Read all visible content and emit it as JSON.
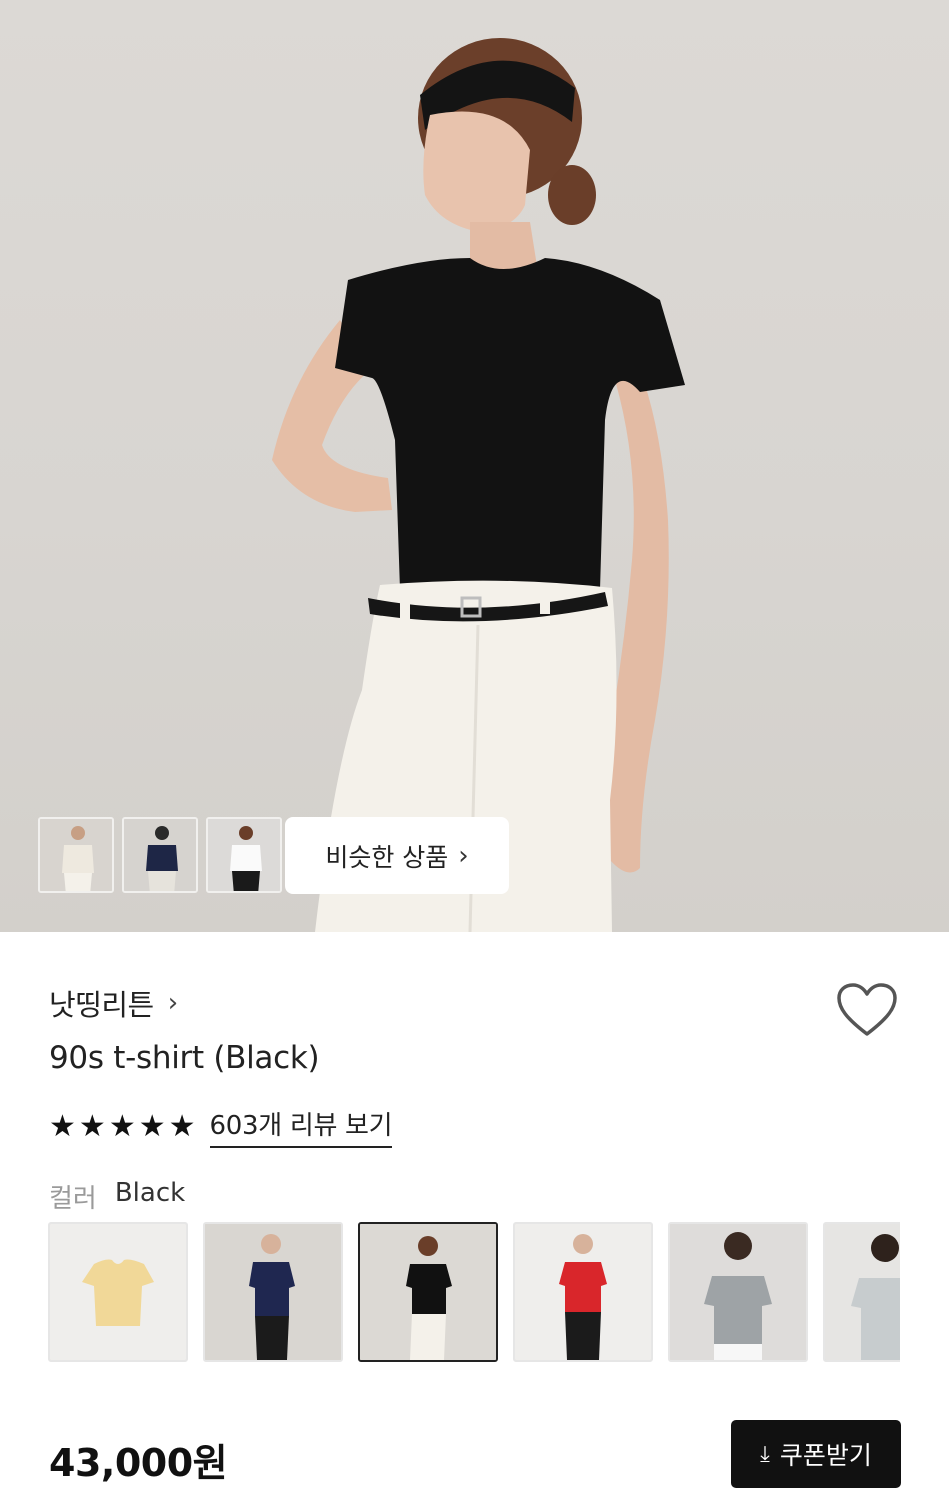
{
  "gallery": {
    "similar_label": "비슷한 상품",
    "thumbnails": [
      "thumb-ivory",
      "thumb-navy",
      "thumb-white"
    ]
  },
  "product": {
    "brand": "낫띵리튼",
    "title": "90s t-shirt (Black)",
    "rating_stars": 5,
    "review_link": "603개 리뷰 보기",
    "color_label": "컬러",
    "color_value": "Black",
    "price": "43,000원"
  },
  "swatches": [
    {
      "name": "yellow",
      "shirt": "#f1d898",
      "active": false
    },
    {
      "name": "navy",
      "shirt": "#1f2750",
      "active": false
    },
    {
      "name": "black",
      "shirt": "#111111",
      "active": true
    },
    {
      "name": "red",
      "shirt": "#d9262b",
      "active": false
    },
    {
      "name": "grey",
      "shirt": "#9ea3a6",
      "active": false
    },
    {
      "name": "light-grey",
      "shirt": "#c7ccce",
      "active": false
    }
  ],
  "actions": {
    "coupon_label": "쿠폰받기"
  },
  "icons": {
    "heart": "heart-outline-icon",
    "star": "star-icon",
    "download": "download-arrow-icon",
    "chevron": "chevron-right-icon"
  },
  "colors": {
    "accent": "#111111",
    "muted": "#9a9a9a"
  }
}
